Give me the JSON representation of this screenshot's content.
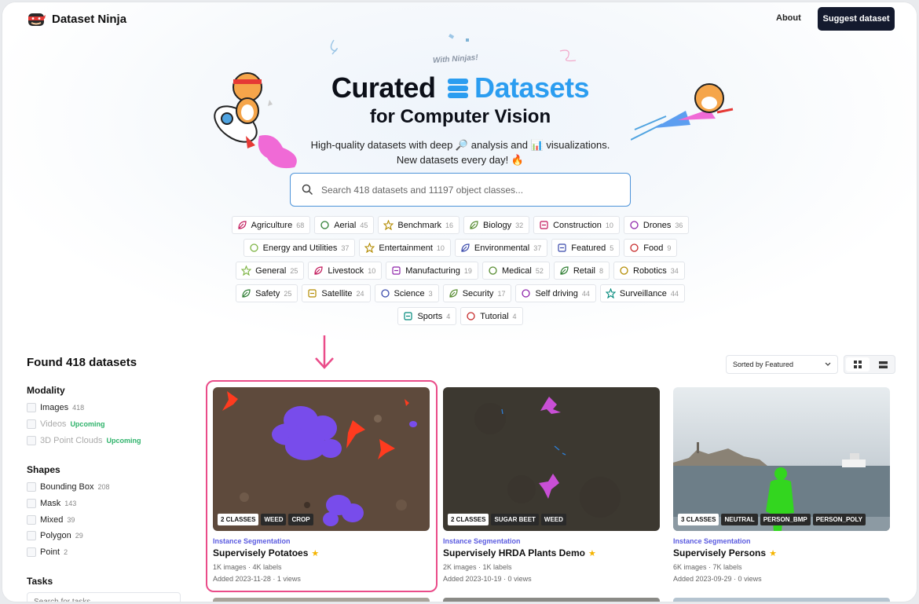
{
  "header": {
    "logo_text": "Dataset Ninja",
    "about": "About",
    "suggest": "Suggest dataset"
  },
  "hero": {
    "tagline": "With Ninjas!",
    "title_a": "Curated",
    "title_b": "Datasets",
    "subtitle": "for Computer Vision",
    "desc1": "High-quality datasets with deep 🔎 analysis and 📊 visualizations.",
    "desc2": "New datasets every day! 🔥"
  },
  "search": {
    "placeholder": "Search 418 datasets and 11197 object classes..."
  },
  "chips": [
    [
      {
        "label": "Agriculture",
        "count": "68",
        "icon": "agriculture-icon",
        "color": "#c2185b"
      },
      {
        "label": "Aerial",
        "count": "45",
        "icon": "aerial-icon",
        "color": "#2e7d32"
      },
      {
        "label": "Benchmark",
        "count": "16",
        "icon": "benchmark-icon",
        "color": "#b38b00"
      },
      {
        "label": "Biology",
        "count": "32",
        "icon": "biology-icon",
        "color": "#558b2f"
      },
      {
        "label": "Construction",
        "count": "10",
        "icon": "construction-icon",
        "color": "#c2185b"
      },
      {
        "label": "Drones",
        "count": "36",
        "icon": "drones-icon",
        "color": "#8e24aa"
      }
    ],
    [
      {
        "label": "Energy and Utilities",
        "count": "37",
        "icon": "energy-icon",
        "color": "#7cb342"
      },
      {
        "label": "Entertainment",
        "count": "10",
        "icon": "entertainment-icon",
        "color": "#b38b00"
      },
      {
        "label": "Environmental",
        "count": "37",
        "icon": "environmental-icon",
        "color": "#3949ab"
      },
      {
        "label": "Featured",
        "count": "5",
        "icon": "featured-icon",
        "color": "#3949ab"
      },
      {
        "label": "Food",
        "count": "9",
        "icon": "food-icon",
        "color": "#c62828"
      }
    ],
    [
      {
        "label": "General",
        "count": "25",
        "icon": "general-icon",
        "color": "#7cb342"
      },
      {
        "label": "Livestock",
        "count": "10",
        "icon": "livestock-icon",
        "color": "#c2185b"
      },
      {
        "label": "Manufacturing",
        "count": "19",
        "icon": "manufacturing-icon",
        "color": "#8e24aa"
      },
      {
        "label": "Medical",
        "count": "52",
        "icon": "medical-icon",
        "color": "#558b2f"
      },
      {
        "label": "Retail",
        "count": "8",
        "icon": "retail-icon",
        "color": "#2e7d32"
      },
      {
        "label": "Robotics",
        "count": "34",
        "icon": "robotics-icon",
        "color": "#b38b00"
      }
    ],
    [
      {
        "label": "Safety",
        "count": "25",
        "icon": "safety-icon",
        "color": "#2e7d32"
      },
      {
        "label": "Satellite",
        "count": "24",
        "icon": "satellite-icon",
        "color": "#b38b00"
      },
      {
        "label": "Science",
        "count": "3",
        "icon": "science-icon",
        "color": "#3949ab"
      },
      {
        "label": "Security",
        "count": "17",
        "icon": "security-icon",
        "color": "#558b2f"
      },
      {
        "label": "Self driving",
        "count": "44",
        "icon": "self-driving-icon",
        "color": "#8e24aa"
      },
      {
        "label": "Surveillance",
        "count": "44",
        "icon": "surveillance-icon",
        "color": "#00897b"
      }
    ],
    [
      {
        "label": "Sports",
        "count": "4",
        "icon": "sports-icon",
        "color": "#00897b"
      },
      {
        "label": "Tutorial",
        "count": "4",
        "icon": "tutorial-icon",
        "color": "#c62828"
      }
    ]
  ],
  "results": {
    "found": "Found 418 datasets",
    "sort": "Sorted by Featured"
  },
  "filters": {
    "modality_title": "Modality",
    "modality": [
      {
        "label": "Images",
        "count": "418",
        "badge": ""
      },
      {
        "label": "Videos",
        "count": "",
        "badge": "Upcoming"
      },
      {
        "label": "3D Point Clouds",
        "count": "",
        "badge": "Upcoming"
      }
    ],
    "shapes_title": "Shapes",
    "shapes": [
      {
        "label": "Bounding Box",
        "count": "208"
      },
      {
        "label": "Mask",
        "count": "143"
      },
      {
        "label": "Mixed",
        "count": "39"
      },
      {
        "label": "Polygon",
        "count": "29"
      },
      {
        "label": "Point",
        "count": "2"
      }
    ],
    "tasks_title": "Tasks",
    "tasks_placeholder": "Search for tasks..."
  },
  "cards": [
    {
      "type": "Instance Segmentation",
      "name": "Supervisely Potatoes",
      "stats": "1K images · 4K labels",
      "added": "Added 2023-11-28 · 1 views",
      "tags": [
        "2 CLASSES",
        "WEED",
        "CROP"
      ]
    },
    {
      "type": "Instance Segmentation",
      "name": "Supervisely HRDA Plants Demo",
      "stats": "2K images · 1K labels",
      "added": "Added 2023-10-19 · 0 views",
      "tags": [
        "2 CLASSES",
        "SUGAR BEET",
        "WEED"
      ]
    },
    {
      "type": "Instance Segmentation",
      "name": "Supervisely Persons",
      "stats": "6K images · 7K labels",
      "added": "Added 2023-09-29 · 0 views",
      "tags": [
        "3 CLASSES",
        "NEUTRAL",
        "PERSON_BMP",
        "PERSON_POLY"
      ]
    }
  ],
  "colors": {
    "accent": "#2b9df0",
    "highlight": "#ea4c89",
    "button": "#141a2e",
    "mask_purple": "#7b4dff",
    "weed_red": "#ff3b1f"
  }
}
